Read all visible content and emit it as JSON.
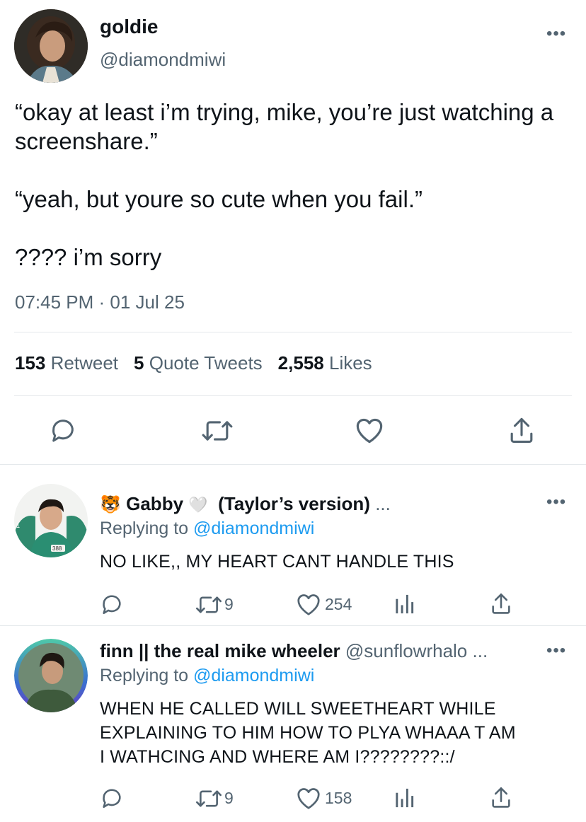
{
  "tweet": {
    "author_name": "goldie",
    "author_handle": "@diamondmiwi",
    "body": "“okay at least i’m trying, mike, you’re just watching a screenshare.”\n\n“yeah, but youre so cute when you fail.”\n\n???? i’m sorry",
    "timestamp": "07:45 PM · 01 Jul 25",
    "stats": {
      "retweets_count": "153",
      "retweets_label": "Retweet",
      "quotes_count": "5",
      "quotes_label": "Quote Tweets",
      "likes_count": "2,558",
      "likes_label": "Likes"
    },
    "actions": [
      "reply-icon",
      "retweet-icon",
      "heart-icon",
      "share-icon"
    ]
  },
  "replies": [
    {
      "emoji": "🐯",
      "author_name": "Gabby",
      "heart_emoji": "🤍",
      "author_suffix": "(Taylor’s version)",
      "ellipsis": "...",
      "replying_prefix": "Replying to",
      "replying_handle": "@diamondmiwi",
      "text": "NO LIKE,, MY HEART CANT HANDLE THIS",
      "avatar_badge": "388",
      "avatar_badge_left": "1",
      "retweets": "9",
      "likes": "254"
    },
    {
      "author_name": "finn || the real mike wheeler",
      "author_handle": "@sunflowrhalo ...",
      "replying_prefix": "Replying to",
      "replying_handle": "@diamondmiwi",
      "text": "WHEN HE CALLED WILL SWEETHEART WHILE\nEXPLAINING TO HIM HOW TO PLYA WHAAA T AM\nI WATHCING AND WHERE AM I????????::/",
      "retweets": "9",
      "likes": "158"
    }
  ],
  "more_label": "•••",
  "colors": {
    "text": "#0f1419",
    "muted": "#536471",
    "link": "#1d9bf0",
    "divider": "#e4e8eb"
  }
}
